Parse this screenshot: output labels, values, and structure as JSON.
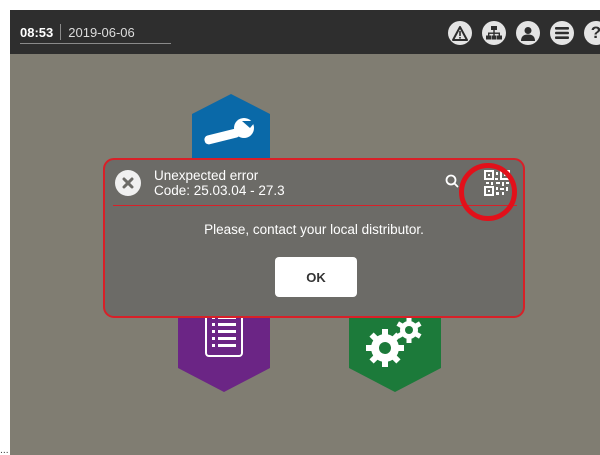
{
  "topbar": {
    "time": "08:53",
    "date": "2019-06-06",
    "icons": [
      "warning-icon",
      "network-icon",
      "user-icon",
      "menu-icon",
      "help-icon"
    ],
    "help_glyph": "?"
  },
  "background_tiles": [
    {
      "icon": "wrench-icon",
      "color": "#0a69a8"
    },
    {
      "icon": "document-list-icon",
      "color": "#6b2585"
    },
    {
      "icon": "gears-icon",
      "color": "#1c7a3a"
    }
  ],
  "dialog": {
    "title": "Unexpected error",
    "code": "Code: 25.03.04 - 27.3",
    "message": "Please, contact your local distributor.",
    "ok_label": "OK",
    "border_color": "#d82028"
  },
  "corner_mark": "..."
}
